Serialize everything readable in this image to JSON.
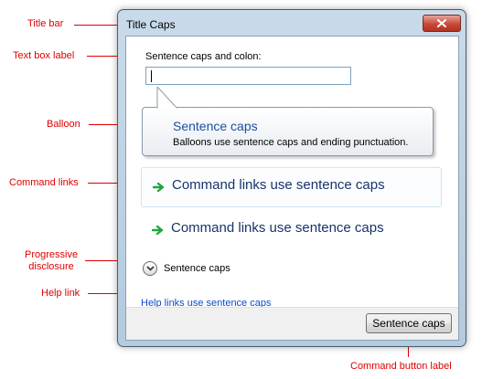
{
  "annotations": {
    "title_bar": "Title bar",
    "text_box_label": "Text box label",
    "balloon": "Balloon",
    "command_links": "Command links",
    "progressive_disclosure_1": "Progressive",
    "progressive_disclosure_2": "disclosure",
    "help_link": "Help link",
    "command_button_label": "Command button label"
  },
  "window": {
    "title": "Title Caps",
    "close_icon": "close-icon"
  },
  "form": {
    "textbox_label": "Sentence caps and colon:",
    "textbox_value": ""
  },
  "balloon": {
    "title": "Sentence caps",
    "body": "Balloons use sentence caps and ending punctuation."
  },
  "command_links": [
    {
      "label": "Command links use sentence  caps",
      "icon": "green-arrow-icon"
    },
    {
      "label": "Command links use sentence  caps",
      "icon": "green-arrow-icon"
    }
  ],
  "disclosure": {
    "label": "Sentence caps",
    "icon": "chevron-down-icon"
  },
  "help_link": "Help links use sentence caps",
  "footer": {
    "button_label": "Sentence caps"
  },
  "colors": {
    "annotation": "#e00000",
    "link": "#0a4cc9",
    "command_link_text": "#17346b",
    "balloon_title": "#1c4fa0",
    "arrow": "#1fa83a"
  }
}
